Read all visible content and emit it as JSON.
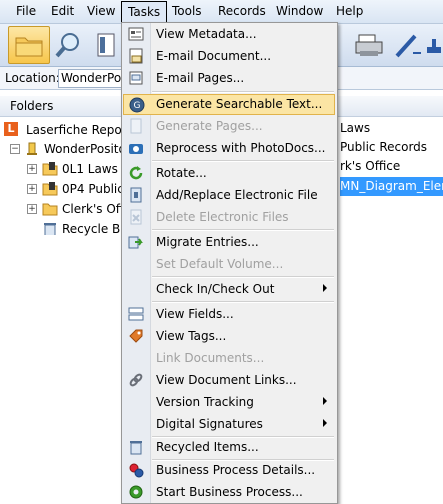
{
  "menubar": {
    "items": [
      "File",
      "Edit",
      "View",
      "Tasks",
      "Tools",
      "Records",
      "Window",
      "Help"
    ],
    "active": "Tasks"
  },
  "location": {
    "label": "Location:",
    "value": "WonderPos"
  },
  "folders": {
    "header": "Folders",
    "tree": [
      "Laserfiche Reposit",
      "WonderPosito",
      "0L1 Laws",
      "0P4 Public",
      "Clerk's Offi",
      "Recycle Bin"
    ]
  },
  "right_pane": {
    "rows": [
      "Laws",
      "Public Records",
      "rk's Office"
    ],
    "selected": "MN_Diagram_Elemen"
  },
  "tasks_menu": {
    "items": [
      "View Metadata...",
      "E-mail Document...",
      "E-mail Pages...",
      "Generate Searchable Text...",
      "Generate Pages...",
      "Reprocess with PhotoDocs...",
      "Rotate...",
      "Add/Replace Electronic File",
      "Delete Electronic Files",
      "Migrate Entries...",
      "Set Default Volume...",
      "Check In/Check Out",
      "View Fields...",
      "View Tags...",
      "Link Documents...",
      "View Document Links...",
      "Version Tracking",
      "Digital Signatures",
      "Recycled Items...",
      "Business Process Details...",
      "Start Business Process..."
    ],
    "highlighted": "Generate Searchable Text...",
    "disabled": [
      "Generate Pages...",
      "Delete Electronic Files",
      "Set Default Volume...",
      "Link Documents..."
    ]
  },
  "colors": {
    "highlight": "#fbe5a4",
    "selection": "#3399ff",
    "laserfiche_logo": "#e8601c"
  }
}
